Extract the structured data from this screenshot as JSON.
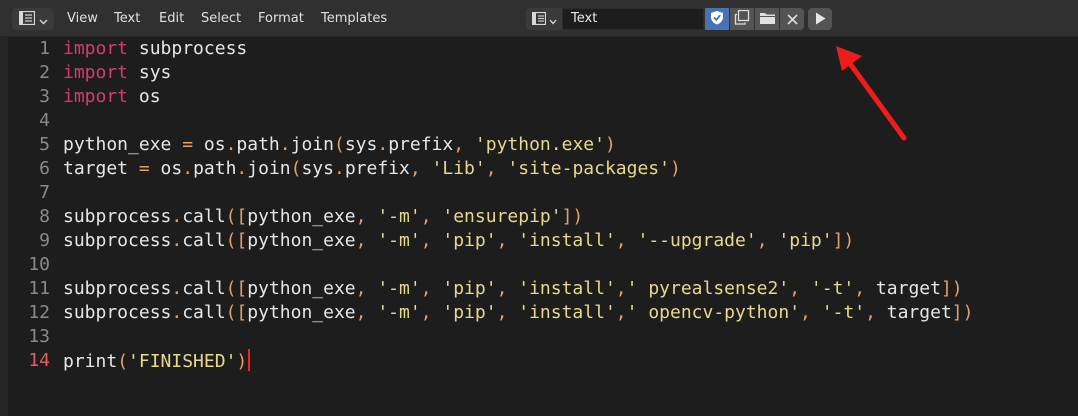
{
  "header": {
    "menus": [
      "View",
      "Text",
      "Edit",
      "Select",
      "Format",
      "Templates"
    ],
    "text_name": "Text"
  },
  "editor": {
    "current_line": 14,
    "lines": [
      {
        "n": "1",
        "tokens": [
          [
            "kw",
            "import"
          ],
          [
            "txt",
            " subprocess"
          ]
        ]
      },
      {
        "n": "2",
        "tokens": [
          [
            "kw",
            "import"
          ],
          [
            "txt",
            " sys"
          ]
        ]
      },
      {
        "n": "3",
        "tokens": [
          [
            "kw",
            "import"
          ],
          [
            "txt",
            " os"
          ]
        ]
      },
      {
        "n": "4",
        "tokens": []
      },
      {
        "n": "5",
        "tokens": [
          [
            "txt",
            "python_exe "
          ],
          [
            "op",
            "="
          ],
          [
            "txt",
            " os"
          ],
          [
            "op",
            "."
          ],
          [
            "txt",
            "path"
          ],
          [
            "op",
            "."
          ],
          [
            "txt",
            "join"
          ],
          [
            "op",
            "("
          ],
          [
            "txt",
            "sys"
          ],
          [
            "op",
            "."
          ],
          [
            "txt",
            "prefix"
          ],
          [
            "op",
            ","
          ],
          [
            "txt",
            " "
          ],
          [
            "str",
            "'python.exe'"
          ],
          [
            "op",
            ")"
          ]
        ]
      },
      {
        "n": "6",
        "tokens": [
          [
            "txt",
            "target "
          ],
          [
            "op",
            "="
          ],
          [
            "txt",
            " os"
          ],
          [
            "op",
            "."
          ],
          [
            "txt",
            "path"
          ],
          [
            "op",
            "."
          ],
          [
            "txt",
            "join"
          ],
          [
            "op",
            "("
          ],
          [
            "txt",
            "sys"
          ],
          [
            "op",
            "."
          ],
          [
            "txt",
            "prefix"
          ],
          [
            "op",
            ","
          ],
          [
            "txt",
            " "
          ],
          [
            "str",
            "'Lib'"
          ],
          [
            "op",
            ","
          ],
          [
            "txt",
            " "
          ],
          [
            "str",
            "'site-packages'"
          ],
          [
            "op",
            ")"
          ]
        ]
      },
      {
        "n": "7",
        "tokens": []
      },
      {
        "n": "8",
        "tokens": [
          [
            "txt",
            "subprocess"
          ],
          [
            "op",
            "."
          ],
          [
            "txt",
            "call"
          ],
          [
            "op",
            "(["
          ],
          [
            "txt",
            "python_exe"
          ],
          [
            "op",
            ","
          ],
          [
            "txt",
            " "
          ],
          [
            "str",
            "'-m'"
          ],
          [
            "op",
            ","
          ],
          [
            "txt",
            " "
          ],
          [
            "str",
            "'ensurepip'"
          ],
          [
            "op",
            "])"
          ]
        ]
      },
      {
        "n": "9",
        "tokens": [
          [
            "txt",
            "subprocess"
          ],
          [
            "op",
            "."
          ],
          [
            "txt",
            "call"
          ],
          [
            "op",
            "(["
          ],
          [
            "txt",
            "python_exe"
          ],
          [
            "op",
            ","
          ],
          [
            "txt",
            " "
          ],
          [
            "str",
            "'-m'"
          ],
          [
            "op",
            ","
          ],
          [
            "txt",
            " "
          ],
          [
            "str",
            "'pip'"
          ],
          [
            "op",
            ","
          ],
          [
            "txt",
            " "
          ],
          [
            "str",
            "'install'"
          ],
          [
            "op",
            ","
          ],
          [
            "txt",
            " "
          ],
          [
            "str",
            "'--upgrade'"
          ],
          [
            "op",
            ","
          ],
          [
            "txt",
            " "
          ],
          [
            "str",
            "'pip'"
          ],
          [
            "op",
            "])"
          ]
        ]
      },
      {
        "n": "10",
        "tokens": []
      },
      {
        "n": "11",
        "tokens": [
          [
            "txt",
            "subprocess"
          ],
          [
            "op",
            "."
          ],
          [
            "txt",
            "call"
          ],
          [
            "op",
            "(["
          ],
          [
            "txt",
            "python_exe"
          ],
          [
            "op",
            ","
          ],
          [
            "txt",
            " "
          ],
          [
            "str",
            "'-m'"
          ],
          [
            "op",
            ","
          ],
          [
            "txt",
            " "
          ],
          [
            "str",
            "'pip'"
          ],
          [
            "op",
            ","
          ],
          [
            "txt",
            " "
          ],
          [
            "str",
            "'install'"
          ],
          [
            "op",
            ","
          ],
          [
            "str",
            "' pyrealsense2'"
          ],
          [
            "op",
            ","
          ],
          [
            "txt",
            " "
          ],
          [
            "str",
            "'-t'"
          ],
          [
            "op",
            ","
          ],
          [
            "txt",
            " target"
          ],
          [
            "op",
            "])"
          ]
        ]
      },
      {
        "n": "12",
        "tokens": [
          [
            "txt",
            "subprocess"
          ],
          [
            "op",
            "."
          ],
          [
            "txt",
            "call"
          ],
          [
            "op",
            "(["
          ],
          [
            "txt",
            "python_exe"
          ],
          [
            "op",
            ","
          ],
          [
            "txt",
            " "
          ],
          [
            "str",
            "'-m'"
          ],
          [
            "op",
            ","
          ],
          [
            "txt",
            " "
          ],
          [
            "str",
            "'pip'"
          ],
          [
            "op",
            ","
          ],
          [
            "txt",
            " "
          ],
          [
            "str",
            "'install'"
          ],
          [
            "op",
            ","
          ],
          [
            "str",
            "' opencv-python'"
          ],
          [
            "op",
            ","
          ],
          [
            "txt",
            " "
          ],
          [
            "str",
            "'-t'"
          ],
          [
            "op",
            ","
          ],
          [
            "txt",
            " target"
          ],
          [
            "op",
            "])"
          ]
        ]
      },
      {
        "n": "13",
        "tokens": []
      },
      {
        "n": "14",
        "tokens": [
          [
            "txt",
            "print"
          ],
          [
            "op",
            "("
          ],
          [
            "str",
            "'FINISHED'"
          ],
          [
            "op",
            ")"
          ]
        ]
      }
    ]
  },
  "colors": {
    "keyword": "#d63a6e",
    "string": "#e6d98c",
    "operator": "#e6a066",
    "text": "#e6e6e6",
    "current_line_number": "#e55c5c",
    "annotation_arrow": "#ee1c1c"
  },
  "icons": {
    "editor_type": "text-editor-icon",
    "textblock_browse": "text-browse-icon",
    "fake_user": "shield-icon",
    "new_text": "new-text-icon",
    "open_text": "folder-icon",
    "unlink": "close-icon",
    "run_script": "play-icon"
  }
}
